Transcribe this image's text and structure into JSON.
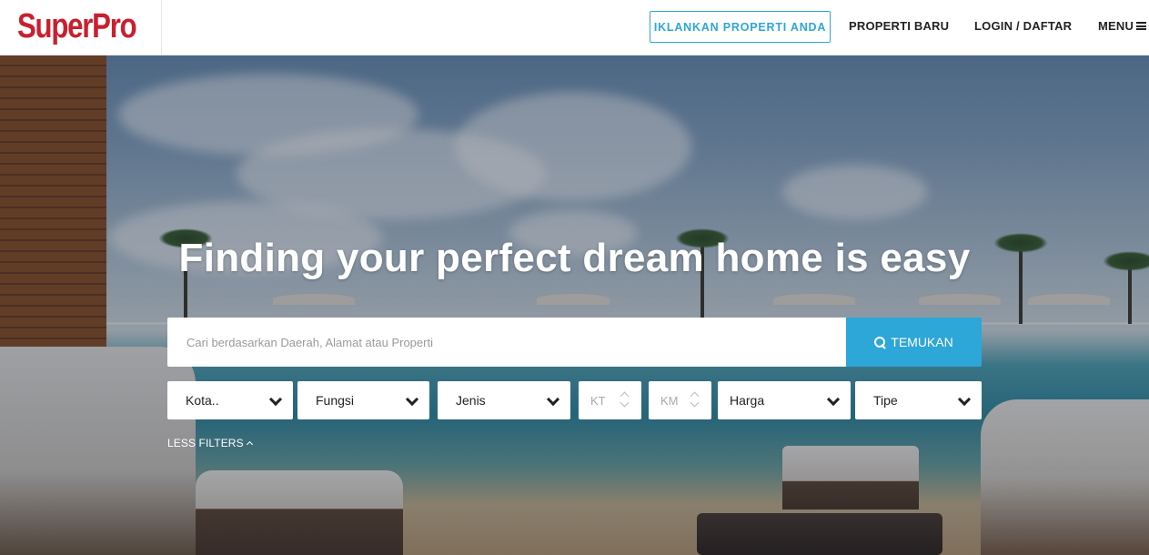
{
  "header": {
    "logo": "SuperPro",
    "cta_label": "IKLANKAN PROPERTI ANDA",
    "nav": {
      "new_label": "PROPERTI BARU",
      "login_label": "LOGIN / DAFTAR",
      "menu_label": "MENU"
    },
    "menu_icon": "hamburger-icon"
  },
  "hero": {
    "headline": "Finding your perfect dream home is easy",
    "search": {
      "placeholder": "Cari berdasarkan Daerah, Alamat atau Properti",
      "value": "",
      "button_label": "TEMUKAN",
      "button_icon": "search-icon"
    },
    "filters": {
      "city": "Kota..",
      "function": "Fungsi",
      "type": "Jenis",
      "bedrooms": "KT",
      "bathrooms": "KM",
      "price": "Harga",
      "kind": "Tipe"
    },
    "less_filters_label": "LESS FILTERS"
  },
  "colors": {
    "brand_red": "#c8202f",
    "accent_blue": "#2da6d8"
  }
}
